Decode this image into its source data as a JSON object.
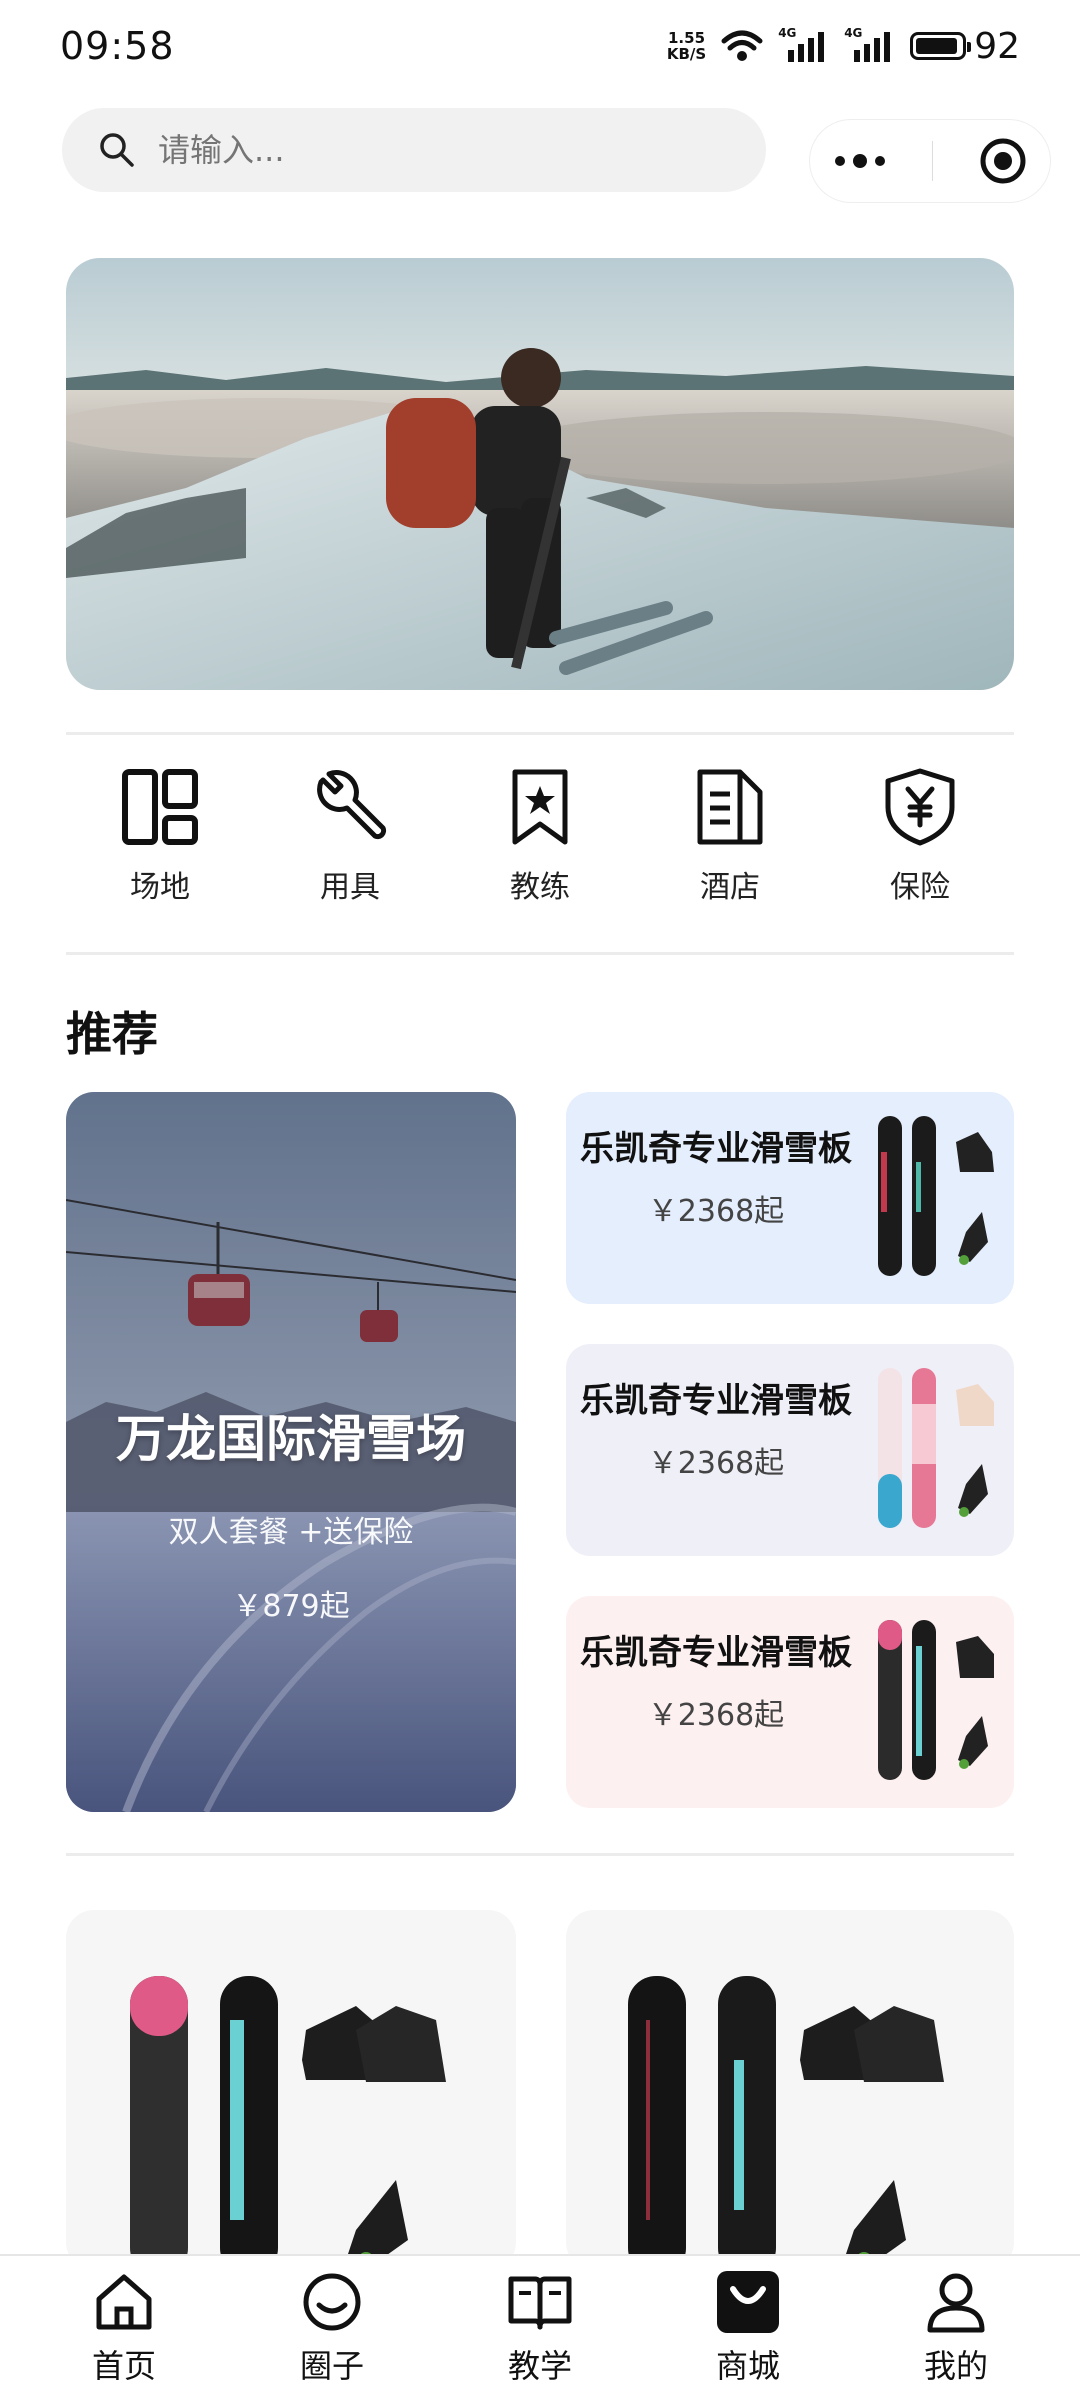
{
  "status_bar": {
    "time": "09:58",
    "net_speed_value": "1.55",
    "net_speed_unit": "KB/S",
    "signal_1": "4G",
    "signal_2": "4G",
    "battery": "92"
  },
  "search": {
    "placeholder": "请输入..."
  },
  "categories": [
    {
      "label": "场地",
      "icon": "venue-icon"
    },
    {
      "label": "用具",
      "icon": "wrench-icon"
    },
    {
      "label": "教练",
      "icon": "coach-bookmark-icon"
    },
    {
      "label": "酒店",
      "icon": "hotel-document-icon"
    },
    {
      "label": "保险",
      "icon": "insurance-shield-icon"
    }
  ],
  "recommend": {
    "title": "推荐",
    "featured": {
      "name": "万龙国际滑雪场",
      "subtitle": "双人套餐 +送保险",
      "price": "￥879起"
    },
    "products": [
      {
        "name": "乐凯奇专业滑雪板",
        "price": "￥2368起",
        "bg": "#e4eefc"
      },
      {
        "name": "乐凯奇专业滑雪板",
        "price": "￥2368起",
        "bg": "#efeff8"
      },
      {
        "name": "乐凯奇专业滑雪板",
        "price": "￥2368起",
        "bg": "#fdf0f1"
      }
    ]
  },
  "tabbar": [
    {
      "label": "首页",
      "icon": "home-icon"
    },
    {
      "label": "圈子",
      "icon": "circle-chat-icon"
    },
    {
      "label": "教学",
      "icon": "book-icon"
    },
    {
      "label": "商城",
      "icon": "shopping-bag-icon"
    },
    {
      "label": "我的",
      "icon": "user-icon"
    }
  ]
}
